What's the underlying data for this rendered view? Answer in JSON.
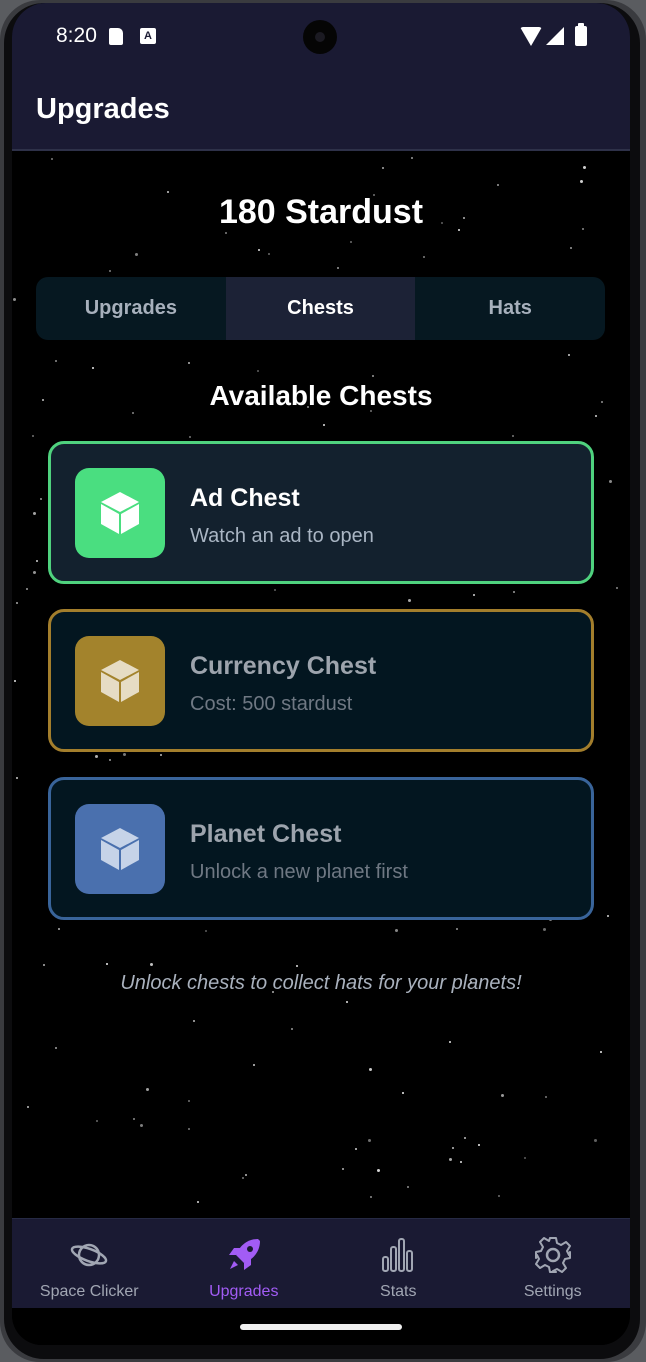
{
  "status_bar": {
    "time": "8:20",
    "a_icon_text": "A"
  },
  "header": {
    "title": "Upgrades"
  },
  "currency": {
    "text": "180 Stardust"
  },
  "tabs": [
    {
      "label": "Upgrades",
      "active": false
    },
    {
      "label": "Chests",
      "active": true
    },
    {
      "label": "Hats",
      "active": false
    }
  ],
  "section_title": "Available Chests",
  "chests": [
    {
      "name": "Ad Chest",
      "description": "Watch an ad to open",
      "icon": "cube-icon",
      "color": "#4ade80",
      "available": true
    },
    {
      "name": "Currency Chest",
      "description": "Cost: 500 stardust",
      "icon": "cube-icon",
      "color": "#a3832c",
      "available": false
    },
    {
      "name": "Planet Chest",
      "description": "Unlock a new planet first",
      "icon": "cube-icon",
      "color": "#4a70ae",
      "available": false
    }
  ],
  "hint": "Unlock chests to collect hats for your planets!",
  "bottom_nav": [
    {
      "label": "Space Clicker",
      "icon": "planet-icon",
      "active": false
    },
    {
      "label": "Upgrades",
      "icon": "rocket-icon",
      "active": true
    },
    {
      "label": "Stats",
      "icon": "bar-chart-icon",
      "active": false
    },
    {
      "label": "Settings",
      "icon": "gear-icon",
      "active": false
    }
  ],
  "colors": {
    "background": "#000000",
    "bar_background": "#1a1a33",
    "accent_active": "#a25cf5",
    "ad_chest_border": "#4fd27e",
    "currency_chest_border": "#a37e2c",
    "planet_chest_border": "#39649a"
  }
}
